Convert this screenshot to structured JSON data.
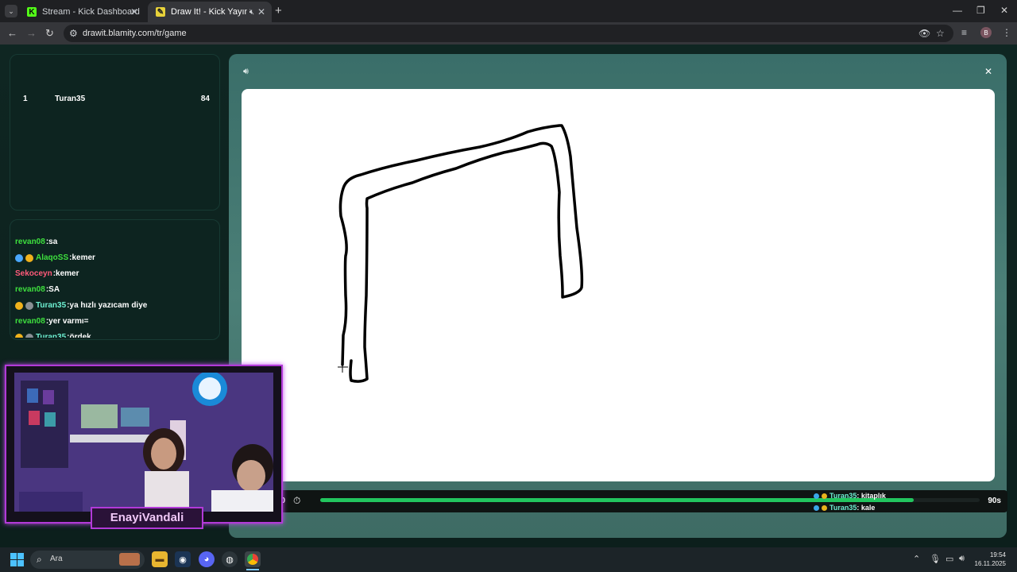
{
  "browser": {
    "tabs": [
      {
        "title": "Stream - Kick Dashboard",
        "active": false
      },
      {
        "title": "Draw It! - Kick Yayınları İçin",
        "active": true
      }
    ],
    "url": "drawit.blamity.com/tr/game",
    "profile_initial": "B"
  },
  "leaderboard": {
    "rows": [
      {
        "rank": "1",
        "name": "Turan35",
        "score": "84"
      }
    ]
  },
  "chat": {
    "messages": [
      {
        "user": "revan08",
        "text": ":sa",
        "color": "#3ee03e",
        "badges": []
      },
      {
        "user": "AlaqoSS",
        "text": ":kemer",
        "color": "#3ee03e",
        "badges": [
          "sword",
          "gold"
        ]
      },
      {
        "user": "Sekoceyn",
        "text": ":kemer",
        "color": "#ff5a7a",
        "badges": []
      },
      {
        "user": "revan08",
        "text": ":SA",
        "color": "#3ee03e",
        "badges": []
      },
      {
        "user": "Turan35",
        "text": ":ya hızlı yazıcam diye",
        "color": "#6ef0d2",
        "badges": [
          "gold",
          "gray"
        ]
      },
      {
        "user": "revan08",
        "text": ":yer varmı=",
        "color": "#3ee03e",
        "badges": []
      },
      {
        "user": "Turan35",
        "text": ":ördek",
        "color": "#6ef0d2",
        "badges": [
          "gold",
          "gray"
        ]
      }
    ]
  },
  "game": {
    "timer_start": "90",
    "timer_end": "90s",
    "progress": 0.9,
    "guesses": [
      {
        "user": "Turan35",
        "text": " : kitaplık"
      },
      {
        "user": "Turan35",
        "text": " : kale"
      }
    ]
  },
  "stream": {
    "name": "EnayiVandali"
  },
  "taskbar": {
    "search_placeholder": "Ara",
    "time": "19:54",
    "date": "16.11.2025"
  }
}
